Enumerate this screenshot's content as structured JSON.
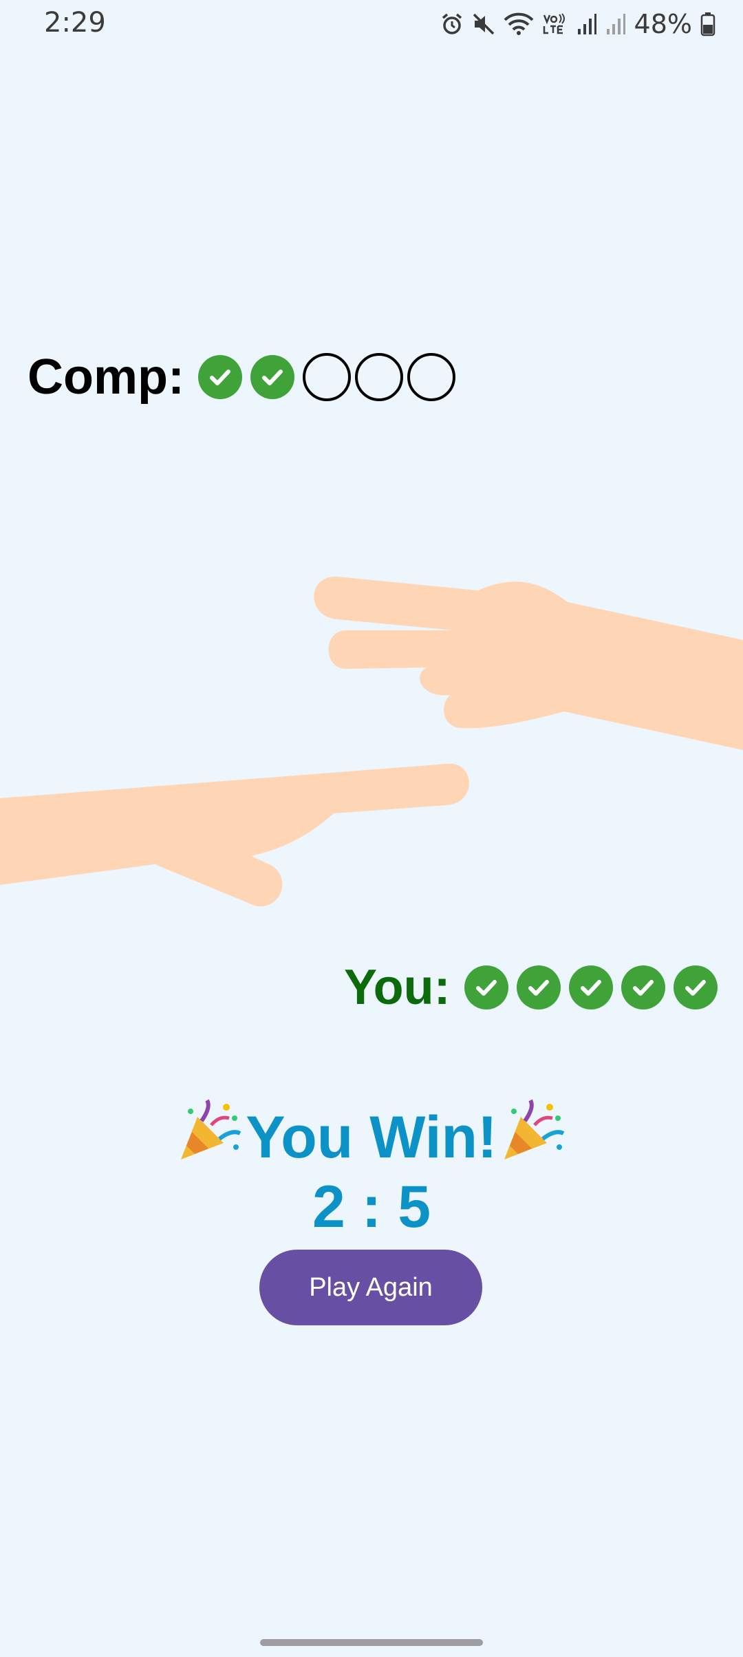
{
  "status_bar": {
    "time": "2:29",
    "battery": "48%",
    "icons": [
      "alarm-icon",
      "mute-icon",
      "wifi-icon",
      "volte-icon",
      "signal-icon",
      "signal-icon",
      "battery-icon"
    ]
  },
  "computer": {
    "label": "Comp:",
    "marks": [
      "win",
      "win",
      "empty",
      "empty",
      "empty"
    ],
    "wins": 2,
    "total": 5
  },
  "player": {
    "label": "You:",
    "marks": [
      "win",
      "win",
      "win",
      "win",
      "win"
    ],
    "wins": 5,
    "total": 5
  },
  "hands": {
    "computer_choice": "scissors",
    "player_choice": "scissors",
    "skin_color": "#fed6b6"
  },
  "result": {
    "title": "You Win!",
    "score": "2 : 5"
  },
  "actions": {
    "play_again": "Play Again"
  },
  "colors": {
    "background": "#eef6fd",
    "win_mark": "#3fa33a",
    "player_label": "#0b6b0b",
    "result_text": "#0d92c7",
    "button": "#6750a4"
  }
}
